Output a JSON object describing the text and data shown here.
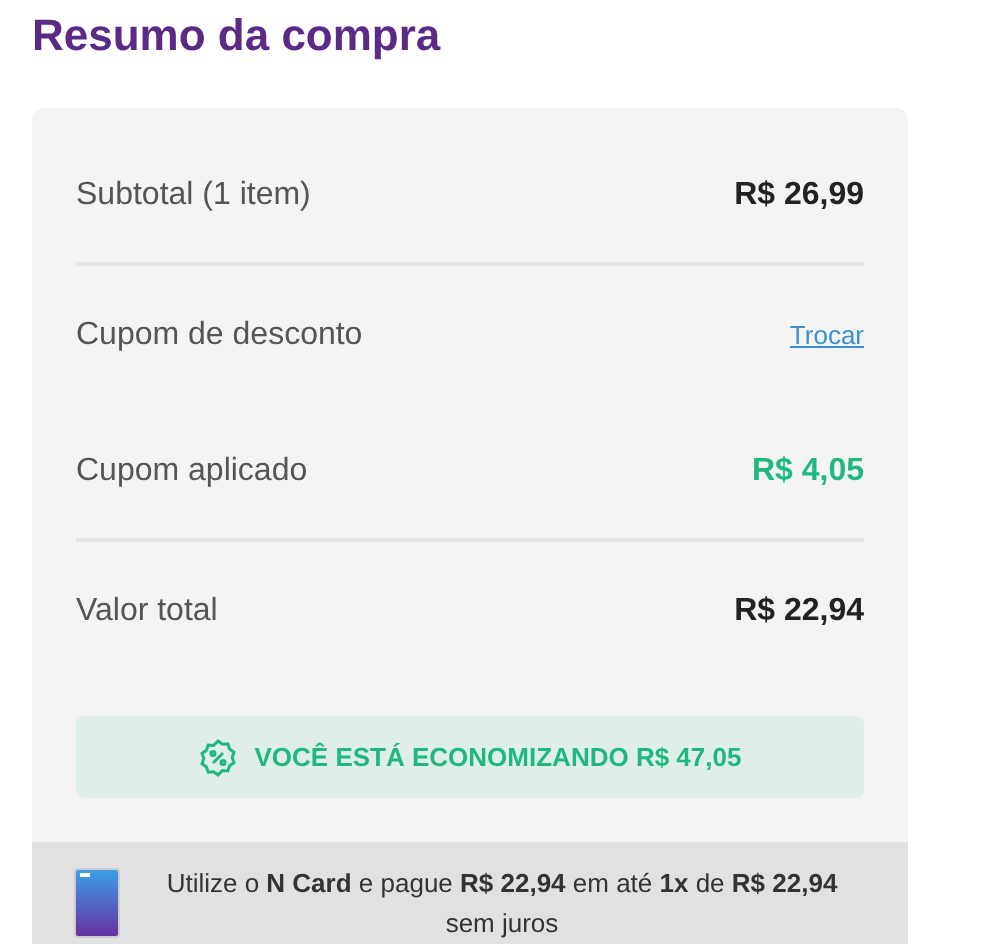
{
  "title": "Resumo da compra",
  "rows": [
    {
      "label": "Subtotal (1 item)",
      "value": "R$ 26,99",
      "kind": "amount",
      "divider_after": true
    },
    {
      "label": "Cupom de desconto",
      "value": "Trocar",
      "kind": "link",
      "divider_after": false
    },
    {
      "label": "Cupom aplicado",
      "value": "R$ 4,05",
      "kind": "discount",
      "divider_after": true
    },
    {
      "label": "Valor total",
      "value": "R$ 22,94",
      "kind": "amount",
      "divider_after": false
    }
  ],
  "savings_banner": "VOCÊ ESTÁ ECONOMIZANDO R$ 47,05",
  "card_offer": "Utilize o **N Card** e pague **R$ 22,94** em até **1x** de **R$ 22,94** sem juros"
}
